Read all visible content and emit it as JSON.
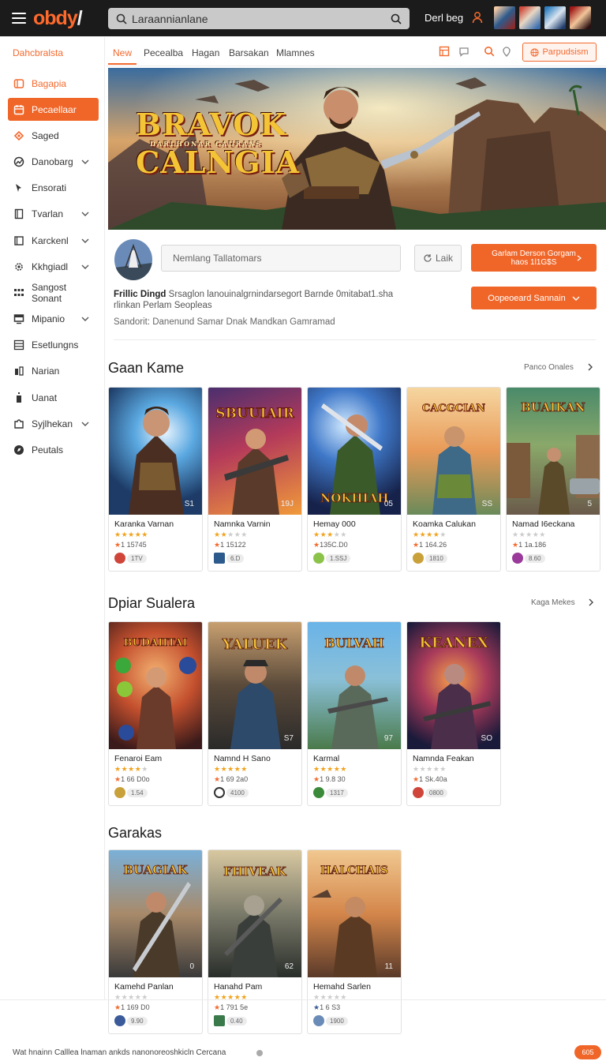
{
  "header": {
    "logo_main": "obdy",
    "logo_mark": "/",
    "search_value": "Laraannianlane",
    "user_name": "Derl beg"
  },
  "sidebar": {
    "title": "Dahcbralsta",
    "items": [
      {
        "label": "Bagapia",
        "icon": "home-icon"
      },
      {
        "label": "Pecaellaar",
        "icon": "calendar-icon"
      },
      {
        "label": "Saged",
        "icon": "tag-icon"
      },
      {
        "label": "Danobarg",
        "icon": "chart-icon"
      },
      {
        "label": "Ensorati",
        "icon": "cursor-icon"
      },
      {
        "label": "Tvarlan",
        "icon": "bookmark-icon"
      },
      {
        "label": "Karckenl",
        "icon": "book-icon"
      },
      {
        "label": "Kkhgiadl",
        "icon": "gear-icon"
      },
      {
        "label": "Sangost Sonant",
        "icon": "grid-icon"
      },
      {
        "label": "Mipanio",
        "icon": "monitor-icon"
      },
      {
        "label": "Esetlungns",
        "icon": "list-icon"
      },
      {
        "label": "Narian",
        "icon": "people-icon"
      },
      {
        "label": "Uanat",
        "icon": "bin-icon"
      },
      {
        "label": "Syjlhekan",
        "icon": "puzzle-icon"
      },
      {
        "label": "Peutals",
        "icon": "compass-icon"
      }
    ]
  },
  "tabs": [
    "New",
    "Pecealba",
    "Hagan",
    "Barsakan",
    "Mlamnes"
  ],
  "toolbar": {
    "cta_label": "Parpudsism"
  },
  "hero": {
    "title_line1": "BRAVOK",
    "subtitle": "DARLHONAR CAURANS",
    "title_line2": "CALNGIA"
  },
  "project": {
    "input_value": "Nemlang Tallatomars",
    "like_label": "Laik",
    "primary_button": "Garlam Derson Gorgam haos 1l1G$S",
    "secondary_button": "Oopeoeard Sannain",
    "desc_bold": "Frillic Dingd",
    "desc_text": "Srsaglon lanouinalgrnindarsegort Barnde 0mitabat1.sha rlinkan Perlam Seopleas",
    "meta": "Sandorit: Danenund Samar Dnak  Mandkan Gamramad"
  },
  "sections": [
    {
      "title": "Gaan Kame",
      "link": "Panco Onales",
      "cards": [
        {
          "name": "Karanka Varnan",
          "rating": 5,
          "stat": "1 15745",
          "tag": "1TV",
          "num": "S1"
        },
        {
          "name": "Namnka Varnin",
          "rating": 2,
          "stat": "1 15122",
          "tag": "6.D",
          "num": "19J"
        },
        {
          "name": "Hemay 000",
          "rating": 3,
          "stat": "135C.D0",
          "tag": "1.SSJ",
          "num": "05"
        },
        {
          "name": "Koamka Calukan",
          "rating": 4,
          "stat": "1 164.26",
          "tag": "1810",
          "num": "SS"
        },
        {
          "name": "Namad I6eckana",
          "rating": 1,
          "stat": "1 1a.186",
          "tag": "8.60",
          "num": "5"
        }
      ]
    },
    {
      "title": "Dpiar Sualera",
      "link": "Kaga Mekes",
      "cards": [
        {
          "name": "Fenaroi Eam",
          "rating": 4,
          "stat": "1 66 D0o",
          "tag": "1.54",
          "num": ""
        },
        {
          "name": "Namnd H Sano",
          "rating": 5,
          "stat": "1 69 2a0",
          "tag": "4100",
          "num": "S7"
        },
        {
          "name": "Karmal",
          "rating": 5,
          "stat": "1 9.8 30",
          "tag": "1317",
          "num": "97"
        },
        {
          "name": "Namnda Feakan",
          "rating": 1,
          "stat": "1 Sk.40a",
          "tag": "0800",
          "num": "SO"
        }
      ]
    },
    {
      "title": "Garakas",
      "link": "",
      "cards": [
        {
          "name": "Kamehd Panlan",
          "rating": 0,
          "stat": "1 169 D0",
          "tag": "9.90",
          "num": "0"
        },
        {
          "name": "Hanahd Pam",
          "rating": 5,
          "stat": "1 791 5e",
          "tag": "0.40",
          "num": "62"
        },
        {
          "name": "Hemahd Sarlen",
          "rating": 0,
          "stat": "1 6 S3",
          "tag": "1900",
          "num": "11"
        }
      ]
    }
  ],
  "footer": {
    "text": "Wat hnainn Calllea lnaman ankds nanonoreoshkicln Cercana",
    "badge": "605"
  }
}
